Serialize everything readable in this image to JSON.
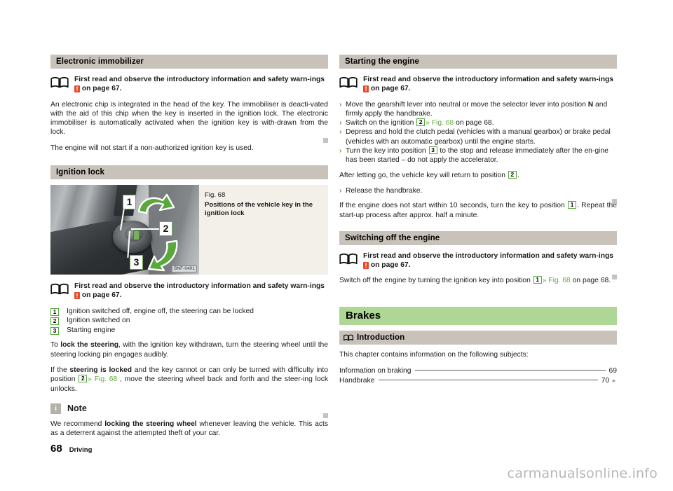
{
  "document": {
    "page_number": "68",
    "footer_label": "Driving",
    "watermark": "carmanualsonline.info"
  },
  "left_column": {
    "section1": {
      "heading": "Electronic immobilizer",
      "reference": {
        "text_before": "First read and observe the introductory information and safety warn-ings ",
        "warn_symbol": "!",
        "text_after": " on page 67."
      },
      "paragraph1": "An electronic chip is integrated in the head of the key. The immobiliser is deacti-vated with the aid of this chip when the key is inserted in the ignition lock. The electronic immobiliser is automatically activated when the ignition key is with-drawn from the lock.",
      "paragraph2": "The engine will not start if a non-authorized ignition key is used."
    },
    "section2": {
      "heading": "Ignition lock",
      "figure": {
        "number": "Fig. 68",
        "title": "Positions of the vehicle key in the ignition lock",
        "code": "BNF-0401",
        "callouts": [
          "1",
          "2",
          "3"
        ]
      },
      "reference": {
        "text_before": "First read and observe the introductory information and safety warn-ings ",
        "warn_symbol": "!",
        "text_after": " on page 67."
      },
      "legend": [
        {
          "num": "1",
          "label": "Ignition switched off, engine off, the steering can be locked"
        },
        {
          "num": "2",
          "label": "Ignition switched on"
        },
        {
          "num": "3",
          "label": "Starting engine"
        }
      ],
      "paragraph_lock": {
        "p1": "To ",
        "b1": "lock the steering",
        "p2": ", with the ignition key withdrawn, turn the steering wheel until the steering locking pin engages audibly."
      },
      "paragraph_locked": {
        "p1": "If the ",
        "b1": "steering is locked",
        "p2": " and the key cannot or can only be turned with difficulty into position ",
        "chip": "2",
        "xref": "» Fig. 68",
        "p3": " , move the steering wheel back and forth and the steer-ing lock unlocks."
      },
      "note": {
        "icon_letter": "i",
        "title": "Note",
        "p1": "We recommend ",
        "b1": "locking the steering wheel",
        "p2": " whenever leaving the vehicle. This acts as a deterrent against the attempted theft of your car."
      }
    }
  },
  "right_column": {
    "section1": {
      "heading": "Starting the engine",
      "reference": {
        "text_before": "First read and observe the introductory information and safety warn-ings ",
        "warn_symbol": "!",
        "text_after": " on page 67."
      },
      "steps": [
        {
          "pre": "Move the gearshift lever into neutral or move the selector lever into position ",
          "bold": "N",
          "post": " and firmly apply the handbrake."
        },
        {
          "pre": "Switch on the ignition ",
          "chip": "2",
          "xref": "» Fig. 68",
          "post": " on page 68."
        },
        {
          "pre": "Depress and hold the clutch pedal (vehicles with a manual gearbox) or brake pedal (vehicles with an automatic gearbox) until the engine starts.",
          "bold": "",
          "post": ""
        },
        {
          "pre": "Turn the key into position ",
          "chip": "3",
          "post": " to the stop and release immediately after the en-gine has been started – do not apply the accelerator."
        }
      ],
      "after_letting_go": {
        "pre": "After letting go, the vehicle key will return to position ",
        "chip": "2",
        "post": "."
      },
      "step_release": "Release the handbrake.",
      "no_start": {
        "pre": "If the engine does not start within 10 seconds, turn the key to position ",
        "chip": "1",
        "post": ". Repeat the start-up process after approx. half a minute."
      }
    },
    "section2": {
      "heading": "Switching off the engine",
      "reference": {
        "text_before": "First read and observe the introductory information and safety warn-ings ",
        "warn_symbol": "!",
        "text_after": " on page 67."
      },
      "paragraph": {
        "pre": "Switch off the engine by turning the ignition key into position ",
        "chip": "1",
        "xref": "» Fig. 68",
        "post": " on page 68."
      }
    },
    "chapter": {
      "title": "Brakes",
      "intro_heading": "Introduction",
      "intro_text": "This chapter contains information on the following subjects:",
      "toc": [
        {
          "label": "Information on braking",
          "page": "69",
          "arrow": false
        },
        {
          "label": "Handbrake",
          "page": "70",
          "arrow": true
        }
      ]
    }
  },
  "colors": {
    "section_header_bg": "#c9c2ba",
    "chapter_header_bg": "#aed694",
    "accent_green": "#62a945",
    "warning_red": "#e8492c",
    "note_grey": "#b4b0aa"
  }
}
